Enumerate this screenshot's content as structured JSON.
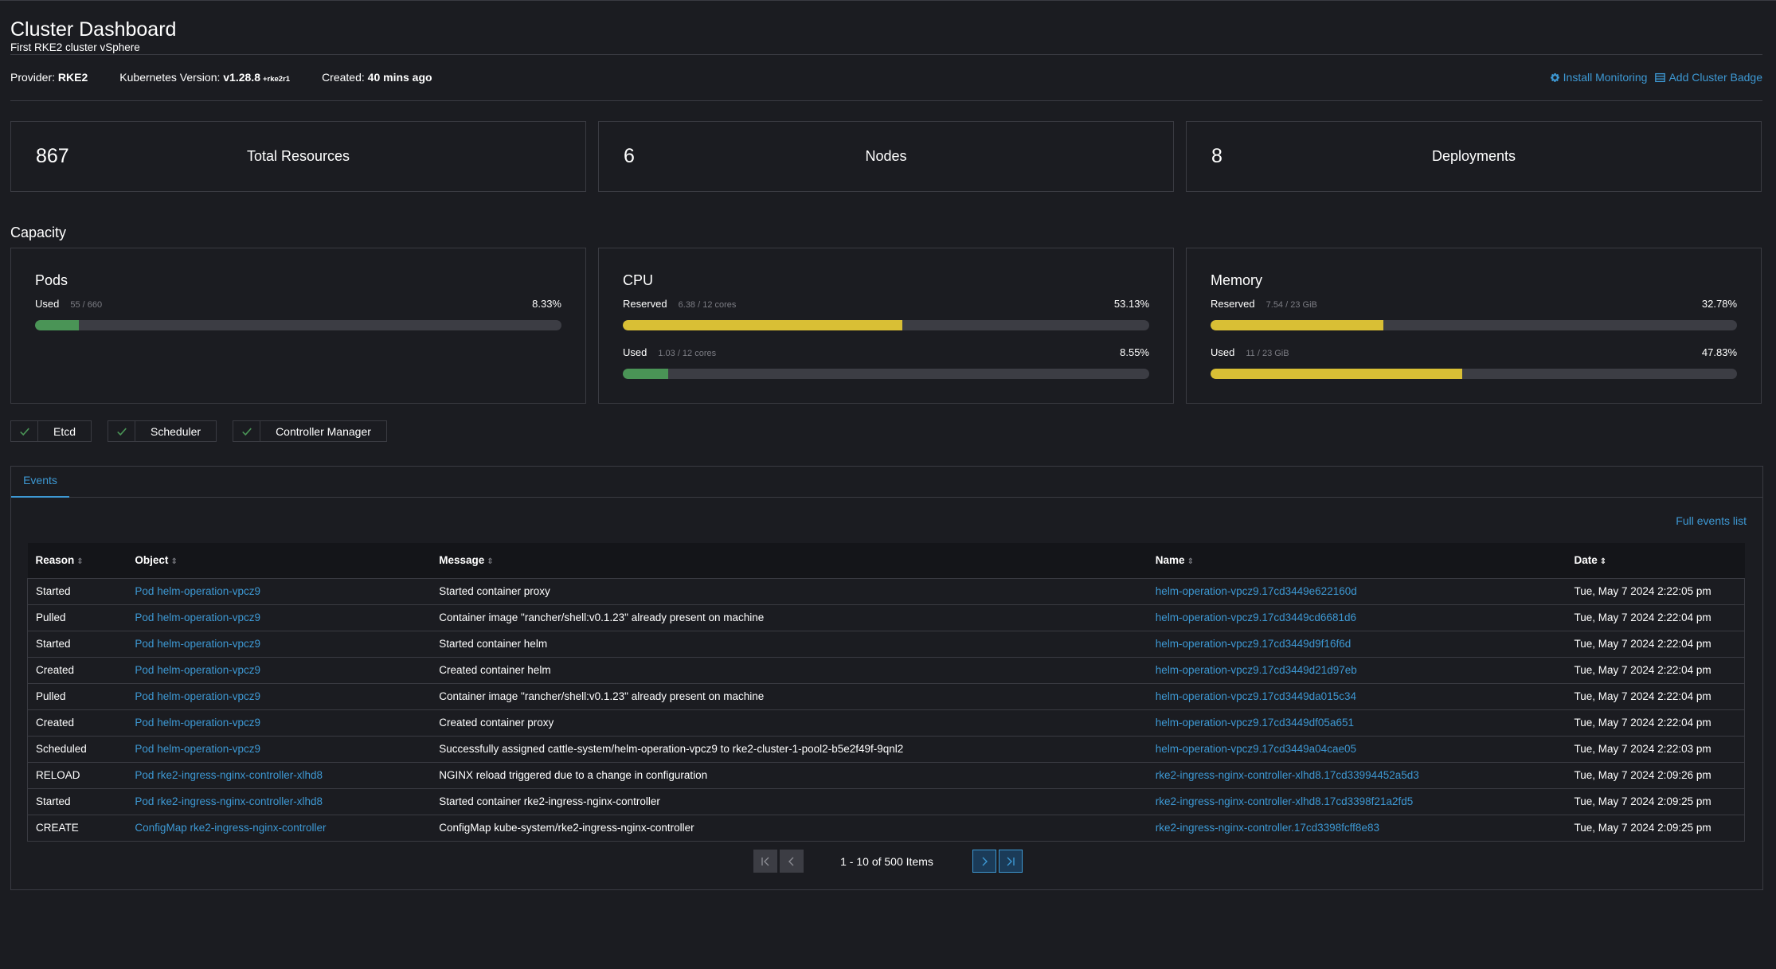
{
  "header": {
    "title": "Cluster Dashboard",
    "subtitle": "First RKE2 cluster vSphere"
  },
  "meta": {
    "provider_label": "Provider:",
    "provider_value": "RKE2",
    "k8s_label": "Kubernetes Version:",
    "k8s_value": "v1.28.8",
    "k8s_suffix": "+rke2r1",
    "created_label": "Created:",
    "created_value": "40 mins ago"
  },
  "actions": {
    "install_monitoring": "Install Monitoring",
    "add_cluster_badge": "Add Cluster Badge"
  },
  "cards": [
    {
      "count": "867",
      "label": "Total Resources"
    },
    {
      "count": "6",
      "label": "Nodes"
    },
    {
      "count": "8",
      "label": "Deployments"
    }
  ],
  "capacity": {
    "title": "Capacity",
    "pods": {
      "title": "Pods",
      "used_label": "Used",
      "used_detail": "55 / 660",
      "used_pct": "8.33%",
      "used_fraction": 0.0833
    },
    "cpu": {
      "title": "CPU",
      "reserved_label": "Reserved",
      "reserved_detail": "6.38 / 12 cores",
      "reserved_pct": "53.13%",
      "reserved_fraction": 0.5313,
      "used_label": "Used",
      "used_detail": "1.03 / 12 cores",
      "used_pct": "8.55%",
      "used_fraction": 0.0855
    },
    "memory": {
      "title": "Memory",
      "reserved_label": "Reserved",
      "reserved_detail": "7.54 / 23 GiB",
      "reserved_pct": "32.78%",
      "reserved_fraction": 0.3278,
      "used_label": "Used",
      "used_detail": "11 / 23 GiB",
      "used_pct": "47.83%",
      "used_fraction": 0.4783
    }
  },
  "components": [
    "Etcd",
    "Scheduler",
    "Controller Manager"
  ],
  "events": {
    "tab": "Events",
    "full_list": "Full events list",
    "columns": [
      "Reason",
      "Object",
      "Message",
      "Name",
      "Date"
    ],
    "rows": [
      [
        "Started",
        "Pod helm-operation-vpcz9",
        "Started container proxy",
        "helm-operation-vpcz9.17cd3449e622160d",
        "Tue, May 7 2024  2:22:05 pm"
      ],
      [
        "Pulled",
        "Pod helm-operation-vpcz9",
        "Container image \"rancher/shell:v0.1.23\" already present on machine",
        "helm-operation-vpcz9.17cd3449cd6681d6",
        "Tue, May 7 2024  2:22:04 pm"
      ],
      [
        "Started",
        "Pod helm-operation-vpcz9",
        "Started container helm",
        "helm-operation-vpcz9.17cd3449d9f16f6d",
        "Tue, May 7 2024  2:22:04 pm"
      ],
      [
        "Created",
        "Pod helm-operation-vpcz9",
        "Created container helm",
        "helm-operation-vpcz9.17cd3449d21d97eb",
        "Tue, May 7 2024  2:22:04 pm"
      ],
      [
        "Pulled",
        "Pod helm-operation-vpcz9",
        "Container image \"rancher/shell:v0.1.23\" already present on machine",
        "helm-operation-vpcz9.17cd3449da015c34",
        "Tue, May 7 2024  2:22:04 pm"
      ],
      [
        "Created",
        "Pod helm-operation-vpcz9",
        "Created container proxy",
        "helm-operation-vpcz9.17cd3449df05a651",
        "Tue, May 7 2024  2:22:04 pm"
      ],
      [
        "Scheduled",
        "Pod helm-operation-vpcz9",
        "Successfully assigned cattle-system/helm-operation-vpcz9 to rke2-cluster-1-pool2-b5e2f49f-9qnl2",
        "helm-operation-vpcz9.17cd3449a04cae05",
        "Tue, May 7 2024  2:22:03 pm"
      ],
      [
        "RELOAD",
        "Pod rke2-ingress-nginx-controller-xlhd8",
        "NGINX reload triggered due to a change in configuration",
        "rke2-ingress-nginx-controller-xlhd8.17cd33994452a5d3",
        "Tue, May 7 2024  2:09:26 pm"
      ],
      [
        "Started",
        "Pod rke2-ingress-nginx-controller-xlhd8",
        "Started container rke2-ingress-nginx-controller",
        "rke2-ingress-nginx-controller-xlhd8.17cd3398f21a2fd5",
        "Tue, May 7 2024  2:09:25 pm"
      ],
      [
        "CREATE",
        "ConfigMap rke2-ingress-nginx-controller",
        "ConfigMap kube-system/rke2-ingress-nginx-controller",
        "rke2-ingress-nginx-controller.17cd3398fcff8e83",
        "Tue, May 7 2024  2:09:25 pm"
      ]
    ],
    "pagination": "1 - 10 of 500 Items"
  },
  "colors": {
    "accent": "#3d98d3",
    "green": "#4a9456",
    "yellow": "#d9bf35",
    "background": "#1b1c21"
  }
}
